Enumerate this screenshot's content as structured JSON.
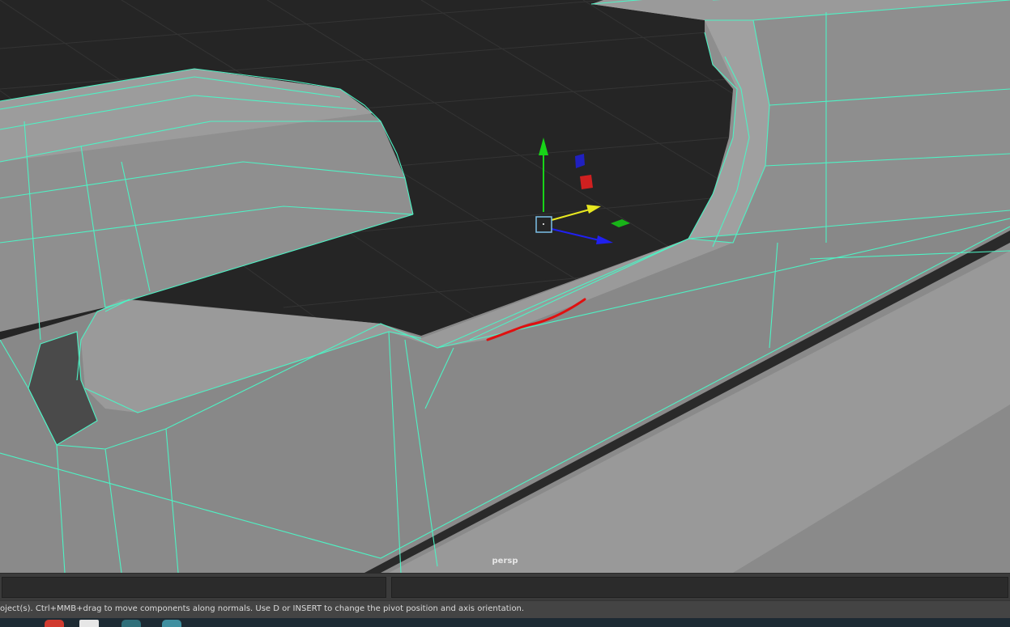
{
  "viewport": {
    "camera_label": "persp",
    "wire_color": "#4ef2c4",
    "background_color": "#252525",
    "mesh_face_color": "#8b8b8b"
  },
  "gizmo": {
    "y_axis_color": "#18d418",
    "x_axis_color": "#e8e820",
    "z_axis_color": "#2020f0",
    "center_handle_color": "#7cc0e8"
  },
  "annotation": {
    "stroke_color": "#e01010"
  },
  "status": {
    "help_text": "oject(s). Ctrl+MMB+drag to move components along normals. Use D or INSERT to change the pivot position and axis orientation."
  },
  "taskbar": {
    "icons": [
      "chrome-icon",
      "maya-icon",
      "app-icon-1",
      "app-icon-2"
    ]
  }
}
